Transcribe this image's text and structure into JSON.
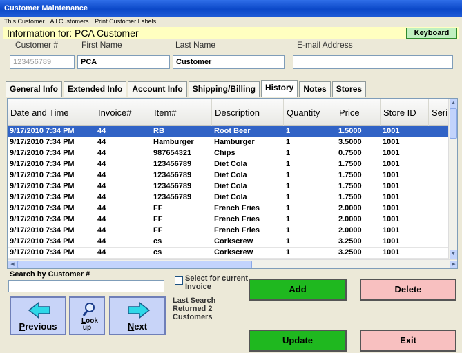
{
  "window": {
    "title": "Customer Maintenance"
  },
  "menu": [
    {
      "label": "This Customer"
    },
    {
      "label": "All Customers"
    },
    {
      "label": "Print Customer Labels"
    }
  ],
  "info": {
    "text": "Information for: PCA Customer",
    "keyboard_label": "Keyboard"
  },
  "fields": {
    "customer_number": {
      "label": "Customer #",
      "value": "123456789"
    },
    "first_name": {
      "label": "First Name",
      "value": "PCA"
    },
    "last_name": {
      "label": "Last Name",
      "value": "Customer"
    },
    "email": {
      "label": "E-mail Address",
      "value": ""
    }
  },
  "tabs": [
    {
      "label": "General Info",
      "active": false
    },
    {
      "label": "Extended Info",
      "active": false
    },
    {
      "label": "Account Info",
      "active": false
    },
    {
      "label": "Shipping/Billing",
      "active": false
    },
    {
      "label": "History",
      "active": true
    },
    {
      "label": "Notes",
      "active": false
    },
    {
      "label": "Stores",
      "active": false
    }
  ],
  "grid": {
    "columns": [
      "Date and Time",
      "Invoice#",
      "Item#",
      "Description",
      "Quantity",
      "Price",
      "Store ID",
      "Seri"
    ],
    "selected_row": 0,
    "rows": [
      [
        "9/17/2010 7:34 PM",
        "44",
        "RB",
        "Root Beer",
        "1",
        "1.5000",
        "1001"
      ],
      [
        "9/17/2010 7:34 PM",
        "44",
        "Hamburger",
        "Hamburger",
        "1",
        "3.5000",
        "1001"
      ],
      [
        "9/17/2010 7:34 PM",
        "44",
        "987654321",
        "Chips",
        "1",
        "0.7500",
        "1001"
      ],
      [
        "9/17/2010 7:34 PM",
        "44",
        "123456789",
        "Diet Cola",
        "1",
        "1.7500",
        "1001"
      ],
      [
        "9/17/2010 7:34 PM",
        "44",
        "123456789",
        "Diet Cola",
        "1",
        "1.7500",
        "1001"
      ],
      [
        "9/17/2010 7:34 PM",
        "44",
        "123456789",
        "Diet Cola",
        "1",
        "1.7500",
        "1001"
      ],
      [
        "9/17/2010 7:34 PM",
        "44",
        "123456789",
        "Diet Cola",
        "1",
        "1.7500",
        "1001"
      ],
      [
        "9/17/2010 7:34 PM",
        "44",
        "FF",
        "French Fries",
        "1",
        "2.0000",
        "1001"
      ],
      [
        "9/17/2010 7:34 PM",
        "44",
        "FF",
        "French Fries",
        "1",
        "2.0000",
        "1001"
      ],
      [
        "9/17/2010 7:34 PM",
        "44",
        "FF",
        "French Fries",
        "1",
        "2.0000",
        "1001"
      ],
      [
        "9/17/2010 7:34 PM",
        "44",
        "cs",
        "Corkscrew",
        "1",
        "3.2500",
        "1001"
      ],
      [
        "9/17/2010 7:34 PM",
        "44",
        "cs",
        "Corkscrew",
        "1",
        "3.2500",
        "1001"
      ]
    ]
  },
  "search": {
    "label": "Search by Customer #",
    "value": ""
  },
  "select_invoice": {
    "label": "Select for current Invoice",
    "checked": false
  },
  "last_search": {
    "text": "Last Search Returned 2 Customers"
  },
  "buttons": {
    "previous": "Previous",
    "lookup": "Look up",
    "next": "Next",
    "add": "Add",
    "delete": "Delete",
    "update": "Update",
    "exit": "Exit"
  },
  "colors": {
    "title_bar": "#0b48c8",
    "info_bar": "#ffffc0",
    "selected_row": "#3163c6",
    "green_button": "#1fb81f",
    "pink_button": "#f8c0c0",
    "nav_button": "#c8d4f8"
  }
}
